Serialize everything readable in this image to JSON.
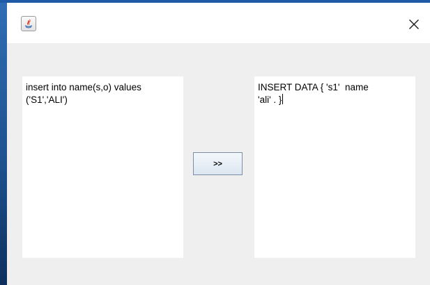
{
  "window": {
    "title": "",
    "app_icon": "java-icon",
    "close_icon": "close-icon"
  },
  "left_textarea": {
    "line1": "insert into name(s,o) values",
    "line2": "('S1','ALI')"
  },
  "right_textarea": {
    "line1": "INSERT DATA { 's1'  name",
    "line2": "'ali' . }"
  },
  "convert_button": {
    "label": ">>"
  },
  "colors": {
    "client_background": "#efefef",
    "textarea_background": "#ffffff",
    "button_border": "#7a8ea3",
    "desktop_accent": "#1e5aa6"
  }
}
